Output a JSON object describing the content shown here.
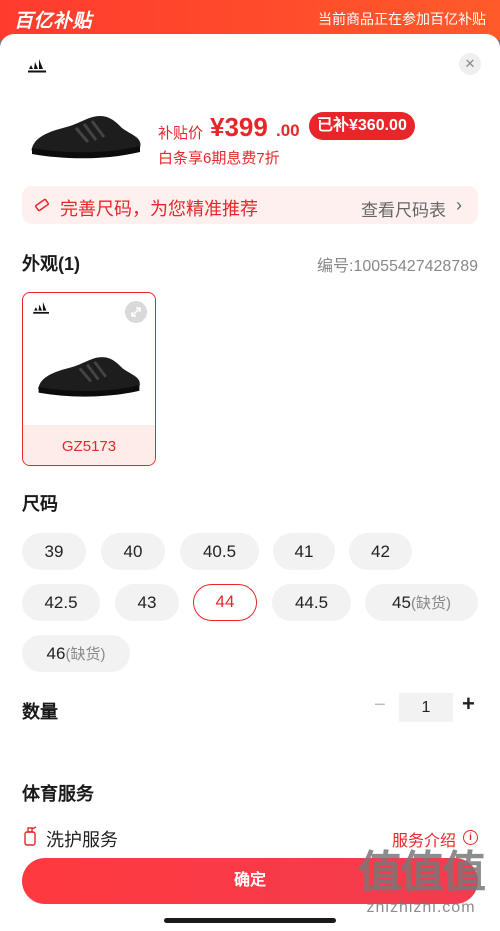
{
  "top_banner": {
    "logo_text": "百亿补贴",
    "note": "当前商品正在参加百亿补贴"
  },
  "product": {
    "brand_logo": "adidas-logo",
    "price_label": "补贴价",
    "price_value": "¥399",
    "price_cents": ".00",
    "subsidy_badge": "已补¥360.00",
    "installment": "白条享6期息费7折"
  },
  "size_banner": {
    "icon": "ruler-icon",
    "text": "完善尺码，为您精准推荐",
    "link": "查看尺码表"
  },
  "appearance": {
    "title": "外观(1)",
    "item_number": "编号:10055427428789",
    "variants": [
      {
        "label": "GZ5173",
        "selected": true
      }
    ]
  },
  "sizes": {
    "title": "尺码",
    "options": [
      {
        "label": "39",
        "oos": ""
      },
      {
        "label": "40",
        "oos": ""
      },
      {
        "label": "40.5",
        "oos": ""
      },
      {
        "label": "41",
        "oos": ""
      },
      {
        "label": "42",
        "oos": ""
      },
      {
        "label": "42.5",
        "oos": ""
      },
      {
        "label": "43",
        "oos": ""
      },
      {
        "label": "44",
        "oos": "",
        "selected": true
      },
      {
        "label": "44.5",
        "oos": ""
      },
      {
        "label": "45",
        "oos": "(缺货)"
      },
      {
        "label": "46",
        "oos": "(缺货)"
      }
    ]
  },
  "quantity": {
    "title": "数量",
    "value": "1",
    "minus": "−",
    "plus": "+"
  },
  "services": {
    "title": "体育服务",
    "wash_label": "洗护服务",
    "intro_link": "服务介绍",
    "info_icon": "i"
  },
  "confirm_label": "确定",
  "watermark": {
    "mark": "值值值",
    "text": "zhizhizhi.com"
  },
  "colors": {
    "accent": "#e8262a",
    "banner": "#ff4a2c",
    "chip_bg": "#f2f2f2"
  }
}
